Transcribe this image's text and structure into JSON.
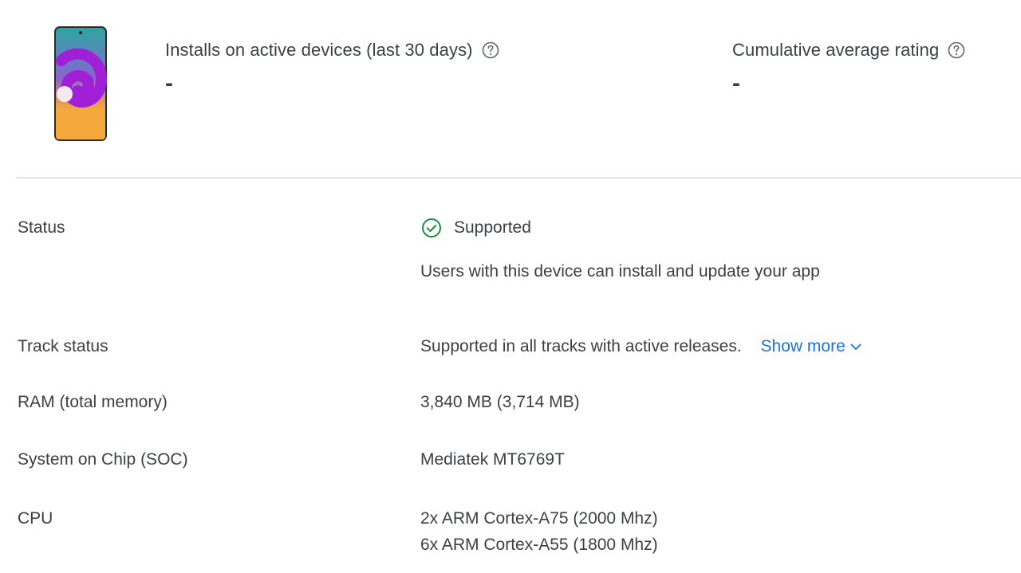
{
  "header": {
    "installs": {
      "label": "Installs on active devices (last 30 days)",
      "value": "-",
      "icon": "help-circle-icon"
    },
    "rating": {
      "label": "Cumulative average rating",
      "value": "-",
      "icon": "help-circle-icon"
    }
  },
  "details": {
    "status": {
      "label": "Status",
      "value": "Supported",
      "description": "Users with this device can install and update your app",
      "icon": "check-circle-icon",
      "icon_color": "#1e8e3e"
    },
    "track_status": {
      "label": "Track status",
      "value": "Supported in all tracks with active releases.",
      "link": "Show more",
      "link_color": "#1a73e8"
    },
    "ram": {
      "label": "RAM (total memory)",
      "value": "3,840 MB (3,714 MB)"
    },
    "soc": {
      "label": "System on Chip (SOC)",
      "value": "Mediatek MT6769T"
    },
    "cpu": {
      "label": "CPU",
      "values": [
        "2x ARM Cortex-A75 (2000 Mhz)",
        "6x ARM Cortex-A55 (1800 Mhz)"
      ]
    }
  }
}
